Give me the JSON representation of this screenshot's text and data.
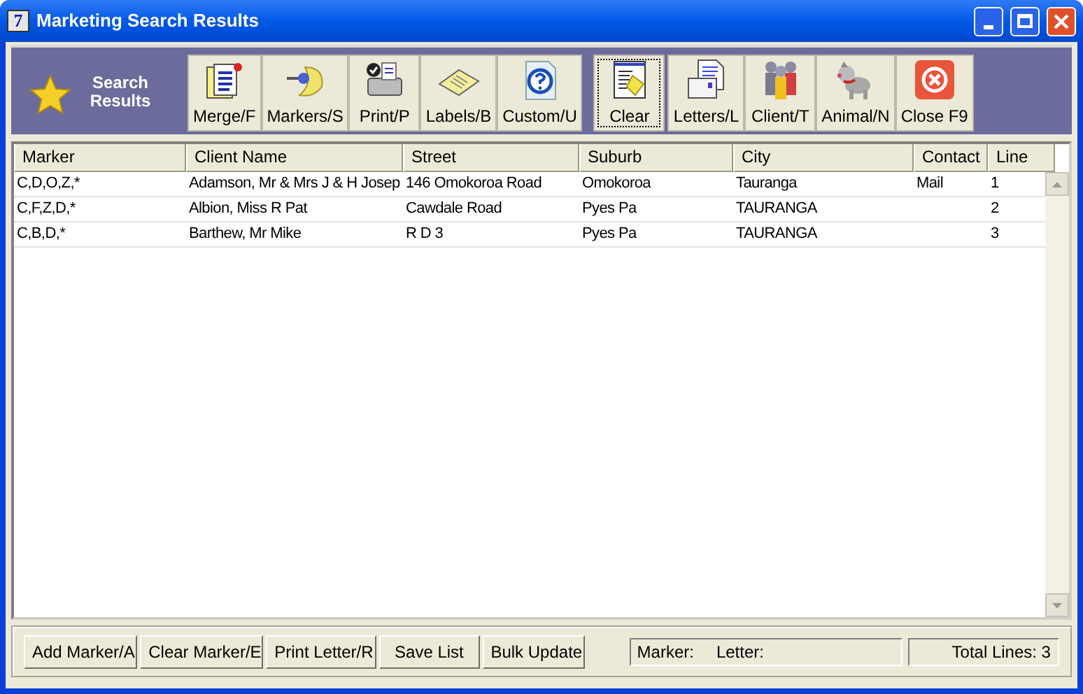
{
  "window": {
    "title": "Marketing Search Results",
    "app_icon": "7"
  },
  "toolbar": {
    "heading": "Search Results",
    "buttons": [
      {
        "label": "Merge/F",
        "kind": "merge",
        "focused": false
      },
      {
        "label": "Markers/S",
        "kind": "pin",
        "focused": false
      },
      {
        "label": "Print/P",
        "kind": "printer",
        "focused": false
      },
      {
        "label": "Labels/B",
        "kind": "labels",
        "focused": false
      },
      {
        "label": "Custom/U",
        "kind": "help",
        "focused": false
      },
      {
        "label": "Clear",
        "kind": "clear",
        "focused": true
      },
      {
        "label": "Letters/L",
        "kind": "letter",
        "focused": false
      },
      {
        "label": "Client/T",
        "kind": "people",
        "focused": false
      },
      {
        "label": "Animal/N",
        "kind": "dog",
        "focused": false
      },
      {
        "label": "Close F9",
        "kind": "close",
        "focused": false
      }
    ]
  },
  "table": {
    "columns": [
      "Marker",
      "Client Name",
      "Street",
      "Suburb",
      "City",
      "Contact",
      "Line"
    ],
    "rows": [
      [
        "C,D,O,Z,*",
        "Adamson, Mr & Mrs J & H Josep",
        "146 Omokoroa Road",
        "Omokoroa",
        "Tauranga",
        "Mail",
        "1"
      ],
      [
        "C,F,Z,D,*",
        "Albion, Miss R Pat",
        "Cawdale Road",
        "Pyes Pa",
        "TAURANGA",
        "",
        "2"
      ],
      [
        "C,B,D,*",
        "Barthew, Mr Mike",
        "R D 3",
        "Pyes Pa",
        "TAURANGA",
        "",
        "3"
      ]
    ]
  },
  "actions": [
    "Add Marker/A",
    "Clear Marker/E",
    "Print Letter/R",
    "Save List",
    "Bulk Update"
  ],
  "status": {
    "marker_label": "Marker:",
    "letter_label": "Letter:",
    "total": "Total Lines: 3"
  }
}
